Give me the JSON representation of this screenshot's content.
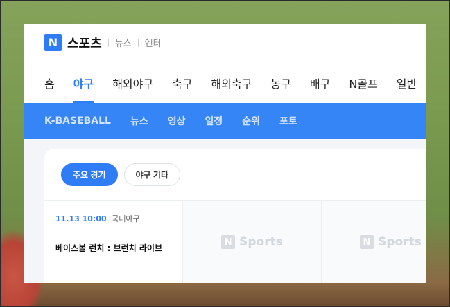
{
  "header": {
    "logo_letter": "N",
    "brand": "스포츠",
    "links": [
      "뉴스",
      "엔터"
    ]
  },
  "main_nav": {
    "items": [
      "홈",
      "야구",
      "해외야구",
      "축구",
      "해외축구",
      "농구",
      "배구",
      "N골프",
      "일반"
    ],
    "active": "야구"
  },
  "sub_nav": {
    "items": [
      "K-BASEBALL",
      "뉴스",
      "영상",
      "일정",
      "순위",
      "포토"
    ]
  },
  "filters": {
    "chips": [
      "주요 경기",
      "야구 기타"
    ],
    "active": "주요 경기"
  },
  "games": [
    {
      "time": "11.13 10:00",
      "league": "국내야구",
      "title": "베이스볼 런치 : 브런치 라이브"
    }
  ],
  "placeholders": [
    {
      "letter": "N",
      "text": "Sports"
    },
    {
      "letter": "N",
      "text": "Sports"
    }
  ],
  "colors": {
    "accent": "#2f7df6",
    "subnav_bg": "#3585f7"
  }
}
